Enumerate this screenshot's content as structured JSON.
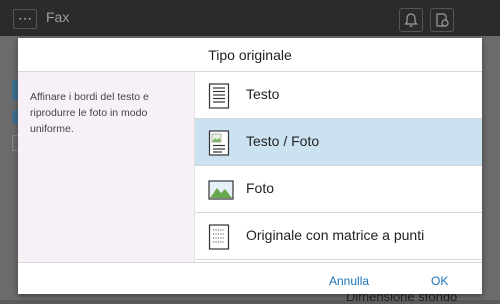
{
  "app": {
    "title": "Fax",
    "menu_icon": "⋯",
    "bg_right_text": "a",
    "bg_bottom_text": "Dimensione sfondo"
  },
  "dialog": {
    "title": "Tipo originale",
    "description": "Affinare i bordi del testo e riprodurre le foto in modo uniforme.",
    "options": [
      {
        "label": "Testo",
        "icon": "text-document-icon",
        "selected": false
      },
      {
        "label": "Testo / Foto",
        "icon": "text-photo-document-icon",
        "selected": true
      },
      {
        "label": "Foto",
        "icon": "photo-icon",
        "selected": false
      },
      {
        "label": "Originale con matrice a punti",
        "icon": "dot-matrix-document-icon",
        "selected": false
      }
    ],
    "cancel_label": "Annulla",
    "ok_label": "OK"
  },
  "colors": {
    "selected_bg": "#cbe3f1",
    "description_bg": "#f7f0f7",
    "button_text": "#1a73b8"
  }
}
